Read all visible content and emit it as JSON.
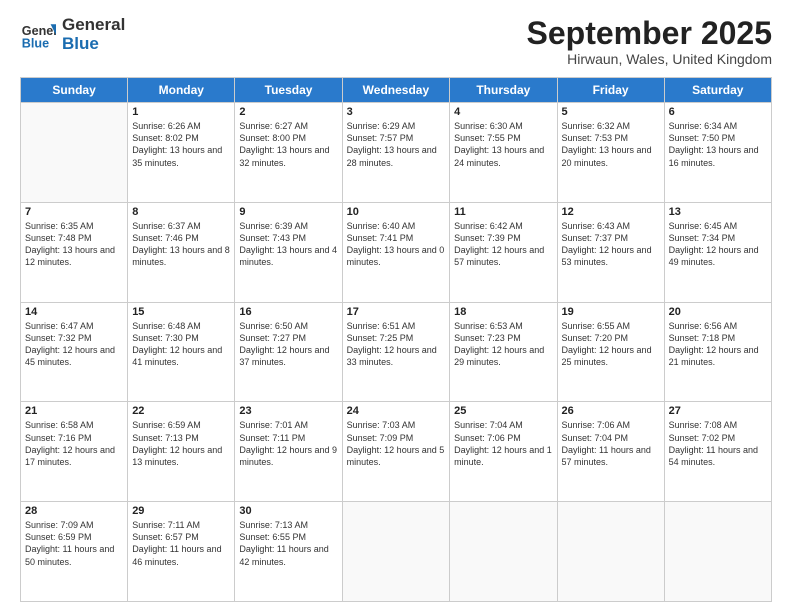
{
  "logo": {
    "line1": "General",
    "line2": "Blue"
  },
  "title": "September 2025",
  "location": "Hirwaun, Wales, United Kingdom",
  "headers": [
    "Sunday",
    "Monday",
    "Tuesday",
    "Wednesday",
    "Thursday",
    "Friday",
    "Saturday"
  ],
  "weeks": [
    [
      {
        "day": "",
        "sunrise": "",
        "sunset": "",
        "daylight": ""
      },
      {
        "day": "1",
        "sunrise": "Sunrise: 6:26 AM",
        "sunset": "Sunset: 8:02 PM",
        "daylight": "Daylight: 13 hours and 35 minutes."
      },
      {
        "day": "2",
        "sunrise": "Sunrise: 6:27 AM",
        "sunset": "Sunset: 8:00 PM",
        "daylight": "Daylight: 13 hours and 32 minutes."
      },
      {
        "day": "3",
        "sunrise": "Sunrise: 6:29 AM",
        "sunset": "Sunset: 7:57 PM",
        "daylight": "Daylight: 13 hours and 28 minutes."
      },
      {
        "day": "4",
        "sunrise": "Sunrise: 6:30 AM",
        "sunset": "Sunset: 7:55 PM",
        "daylight": "Daylight: 13 hours and 24 minutes."
      },
      {
        "day": "5",
        "sunrise": "Sunrise: 6:32 AM",
        "sunset": "Sunset: 7:53 PM",
        "daylight": "Daylight: 13 hours and 20 minutes."
      },
      {
        "day": "6",
        "sunrise": "Sunrise: 6:34 AM",
        "sunset": "Sunset: 7:50 PM",
        "daylight": "Daylight: 13 hours and 16 minutes."
      }
    ],
    [
      {
        "day": "7",
        "sunrise": "Sunrise: 6:35 AM",
        "sunset": "Sunset: 7:48 PM",
        "daylight": "Daylight: 13 hours and 12 minutes."
      },
      {
        "day": "8",
        "sunrise": "Sunrise: 6:37 AM",
        "sunset": "Sunset: 7:46 PM",
        "daylight": "Daylight: 13 hours and 8 minutes."
      },
      {
        "day": "9",
        "sunrise": "Sunrise: 6:39 AM",
        "sunset": "Sunset: 7:43 PM",
        "daylight": "Daylight: 13 hours and 4 minutes."
      },
      {
        "day": "10",
        "sunrise": "Sunrise: 6:40 AM",
        "sunset": "Sunset: 7:41 PM",
        "daylight": "Daylight: 13 hours and 0 minutes."
      },
      {
        "day": "11",
        "sunrise": "Sunrise: 6:42 AM",
        "sunset": "Sunset: 7:39 PM",
        "daylight": "Daylight: 12 hours and 57 minutes."
      },
      {
        "day": "12",
        "sunrise": "Sunrise: 6:43 AM",
        "sunset": "Sunset: 7:37 PM",
        "daylight": "Daylight: 12 hours and 53 minutes."
      },
      {
        "day": "13",
        "sunrise": "Sunrise: 6:45 AM",
        "sunset": "Sunset: 7:34 PM",
        "daylight": "Daylight: 12 hours and 49 minutes."
      }
    ],
    [
      {
        "day": "14",
        "sunrise": "Sunrise: 6:47 AM",
        "sunset": "Sunset: 7:32 PM",
        "daylight": "Daylight: 12 hours and 45 minutes."
      },
      {
        "day": "15",
        "sunrise": "Sunrise: 6:48 AM",
        "sunset": "Sunset: 7:30 PM",
        "daylight": "Daylight: 12 hours and 41 minutes."
      },
      {
        "day": "16",
        "sunrise": "Sunrise: 6:50 AM",
        "sunset": "Sunset: 7:27 PM",
        "daylight": "Daylight: 12 hours and 37 minutes."
      },
      {
        "day": "17",
        "sunrise": "Sunrise: 6:51 AM",
        "sunset": "Sunset: 7:25 PM",
        "daylight": "Daylight: 12 hours and 33 minutes."
      },
      {
        "day": "18",
        "sunrise": "Sunrise: 6:53 AM",
        "sunset": "Sunset: 7:23 PM",
        "daylight": "Daylight: 12 hours and 29 minutes."
      },
      {
        "day": "19",
        "sunrise": "Sunrise: 6:55 AM",
        "sunset": "Sunset: 7:20 PM",
        "daylight": "Daylight: 12 hours and 25 minutes."
      },
      {
        "day": "20",
        "sunrise": "Sunrise: 6:56 AM",
        "sunset": "Sunset: 7:18 PM",
        "daylight": "Daylight: 12 hours and 21 minutes."
      }
    ],
    [
      {
        "day": "21",
        "sunrise": "Sunrise: 6:58 AM",
        "sunset": "Sunset: 7:16 PM",
        "daylight": "Daylight: 12 hours and 17 minutes."
      },
      {
        "day": "22",
        "sunrise": "Sunrise: 6:59 AM",
        "sunset": "Sunset: 7:13 PM",
        "daylight": "Daylight: 12 hours and 13 minutes."
      },
      {
        "day": "23",
        "sunrise": "Sunrise: 7:01 AM",
        "sunset": "Sunset: 7:11 PM",
        "daylight": "Daylight: 12 hours and 9 minutes."
      },
      {
        "day": "24",
        "sunrise": "Sunrise: 7:03 AM",
        "sunset": "Sunset: 7:09 PM",
        "daylight": "Daylight: 12 hours and 5 minutes."
      },
      {
        "day": "25",
        "sunrise": "Sunrise: 7:04 AM",
        "sunset": "Sunset: 7:06 PM",
        "daylight": "Daylight: 12 hours and 1 minute."
      },
      {
        "day": "26",
        "sunrise": "Sunrise: 7:06 AM",
        "sunset": "Sunset: 7:04 PM",
        "daylight": "Daylight: 11 hours and 57 minutes."
      },
      {
        "day": "27",
        "sunrise": "Sunrise: 7:08 AM",
        "sunset": "Sunset: 7:02 PM",
        "daylight": "Daylight: 11 hours and 54 minutes."
      }
    ],
    [
      {
        "day": "28",
        "sunrise": "Sunrise: 7:09 AM",
        "sunset": "Sunset: 6:59 PM",
        "daylight": "Daylight: 11 hours and 50 minutes."
      },
      {
        "day": "29",
        "sunrise": "Sunrise: 7:11 AM",
        "sunset": "Sunset: 6:57 PM",
        "daylight": "Daylight: 11 hours and 46 minutes."
      },
      {
        "day": "30",
        "sunrise": "Sunrise: 7:13 AM",
        "sunset": "Sunset: 6:55 PM",
        "daylight": "Daylight: 11 hours and 42 minutes."
      },
      {
        "day": "",
        "sunrise": "",
        "sunset": "",
        "daylight": ""
      },
      {
        "day": "",
        "sunrise": "",
        "sunset": "",
        "daylight": ""
      },
      {
        "day": "",
        "sunrise": "",
        "sunset": "",
        "daylight": ""
      },
      {
        "day": "",
        "sunrise": "",
        "sunset": "",
        "daylight": ""
      }
    ]
  ]
}
